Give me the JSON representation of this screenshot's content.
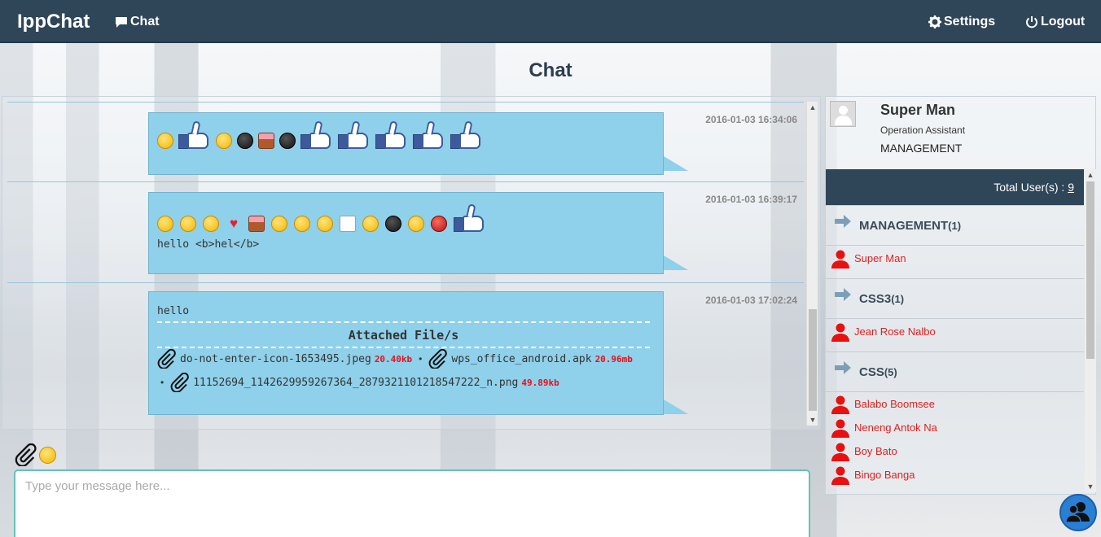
{
  "navbar": {
    "brand": "IppChat",
    "chat_label": "Chat",
    "settings_label": "Settings",
    "logout_label": "Logout"
  },
  "page_title": "Chat",
  "messages": [
    {
      "timestamp": "2016-01-03 16:34:06",
      "emojis": [
        "smiley",
        "thumbs-up",
        "sad",
        "dark-face",
        "cake",
        "helmet",
        "thumbs-up",
        "thumbs-up",
        "thumbs-up",
        "thumbs-up",
        "thumbs-up"
      ]
    },
    {
      "timestamp": "2016-01-03 16:39:17",
      "emojis": [
        "smiley",
        "sleepy",
        "thinking",
        "heart",
        "cake",
        "grimace",
        "surprised",
        "bee",
        "mail",
        "grin",
        "glasses",
        "wink",
        "devil",
        "thumbs-up"
      ],
      "text": "hello <b>hel</b>"
    },
    {
      "timestamp": "2016-01-03 17:02:24",
      "text": "hello",
      "attach_title": "Attached File/s",
      "files": [
        {
          "name": "do-not-enter-icon-1653495.jpeg",
          "size": "20.40kb"
        },
        {
          "name": "wps_office_android.apk",
          "size": "20.96mb"
        },
        {
          "name": "11152694_1142629959267364_2879321101218547222_n.png",
          "size": "49.89kb"
        }
      ],
      "separator": "•"
    }
  ],
  "composer": {
    "placeholder": "Type your message here..."
  },
  "profile": {
    "name": "Super Man",
    "role": "Operation Assistant",
    "department": "MANAGEMENT"
  },
  "total_users": {
    "label": "Total User(s) : ",
    "count": "9"
  },
  "groups": [
    {
      "name": "MANAGEMENT",
      "count": "(1)",
      "users": [
        "Super Man"
      ]
    },
    {
      "name": "CSS3",
      "count": "(1)",
      "users": [
        "Jean Rose Nalbo"
      ]
    },
    {
      "name": "CSS",
      "count": "(5)",
      "users": [
        "Balabo Boomsee",
        "Neneng Antok Na",
        "Boy Bato",
        "Bingo Banga"
      ]
    }
  ],
  "colors": {
    "navbar": "#2f4558",
    "bubble": "#8fd0ea",
    "user_name": "#e02020",
    "accent": "#66c2b5",
    "fab": "#2a7fd4"
  }
}
